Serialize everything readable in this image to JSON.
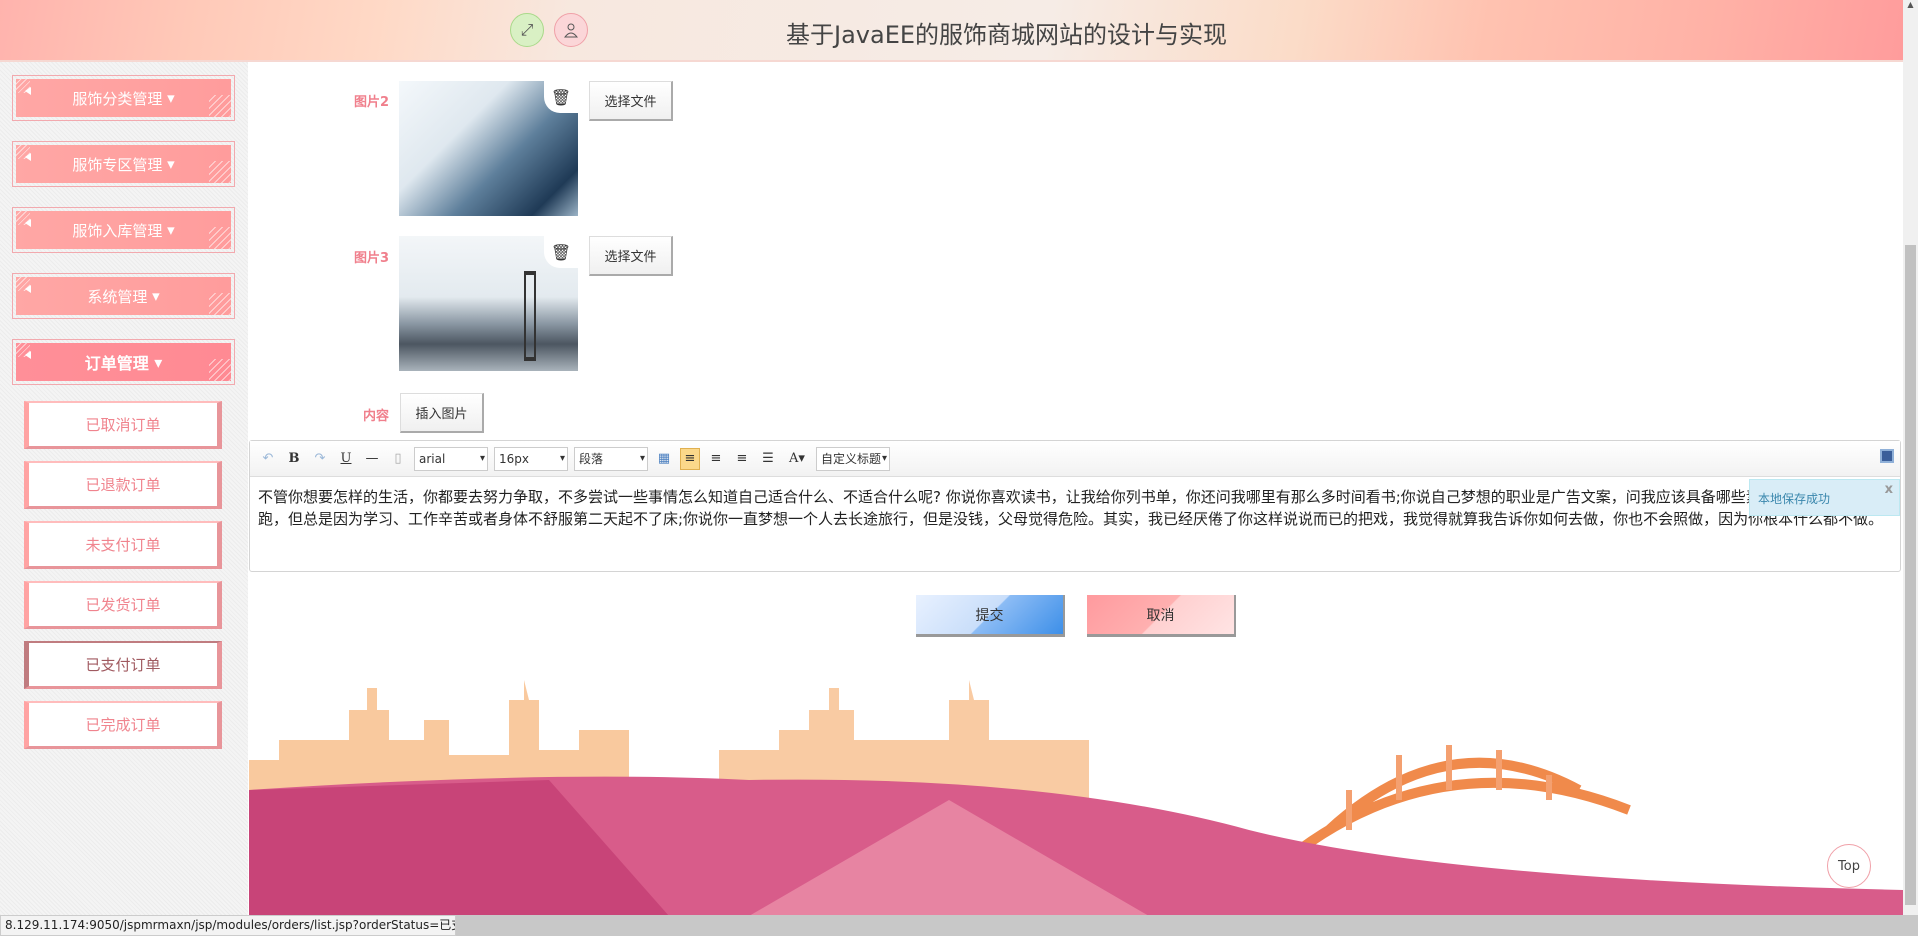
{
  "header": {
    "title": "基于JavaEE的服饰商城网站的设计与实现",
    "icons": [
      "fullscreen-icon",
      "user-icon"
    ]
  },
  "sidebar": {
    "menus": [
      {
        "label": "服饰分类管理"
      },
      {
        "label": "服饰专区管理"
      },
      {
        "label": "服饰入库管理"
      },
      {
        "label": "系统管理"
      },
      {
        "label": "订单管理",
        "active": true
      }
    ],
    "submenu": [
      {
        "label": "已取消订单"
      },
      {
        "label": "已退款订单"
      },
      {
        "label": "未支付订单"
      },
      {
        "label": "已发货订单"
      },
      {
        "label": "已支付订单",
        "hover": true
      },
      {
        "label": "已完成订单"
      }
    ]
  },
  "form": {
    "pic2_label": "图片2",
    "pic3_label": "图片3",
    "choose_file": "选择文件",
    "content_label": "内容",
    "insert_image": "插入图片",
    "submit": "提交",
    "cancel": "取消"
  },
  "editor": {
    "font": "arial",
    "size": "16px",
    "paragraph": "段落",
    "custom_title": "自定义标题",
    "bold": "B",
    "underline": "U",
    "fontcolor": "A",
    "text": "不管你想要怎样的生活，你都要去努力争取，不多尝试一些事情怎么知道自己适合什么、不适合什么呢? 你说你喜欢读书，让我给你列书单，你还问我哪里有那么多时间看书;你说自己梦想的职业是广告文案，问我应该具备哪些素质;你说你计划晨跑，但总是因为学习、工作辛苦或者身体不舒服第二天起不了床;你说你一直梦想一个人去长途旅行，但是没钱，父母觉得危险。其实，我已经厌倦了你这样说说而已的把戏，我觉得就算我告诉你如何去做，你也不会照做，因为你根本什么都不做。"
  },
  "notice": {
    "text": "本地保存成功",
    "close": "x"
  },
  "status_url": "8.129.11.174:9050/jspmrmaxn/jsp/modules/orders/list.jsp?orderStatus=已支付",
  "top_button": "Top",
  "colors": {
    "accent": "#ff9c9c",
    "label": "#f07f8c",
    "submit": "#4a9cf0"
  }
}
